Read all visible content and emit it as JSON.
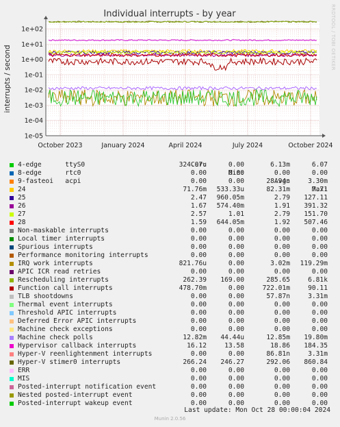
{
  "chart_data": {
    "type": "line",
    "title": "Individual interrupts - by year",
    "ylabel": "interrupts / second",
    "yscale": "log",
    "ylim": [
      1e-05,
      300
    ],
    "y_ticks": [
      "1e+02",
      "1e+01",
      "1e+00",
      "1e-01",
      "1e-02",
      "1e-03",
      "1e-04",
      "1e-05"
    ],
    "x_ticks": [
      "October 2023",
      "January 2024",
      "April 2024",
      "July 2024",
      "October 2024"
    ],
    "grid": true,
    "series": [
      {
        "name": "Hyper-V stimer0 interrupts",
        "color": "#666600",
        "level": 290
      },
      {
        "name": "Hypervisor callback interrupts",
        "color": "#cc00cc",
        "level": 18
      },
      {
        "name": "Rescheduling interrupts",
        "color": "#8fb21d",
        "level": 285
      },
      {
        "name": "24",
        "color": "#ffcc00",
        "level": 3.5
      },
      {
        "name": "25",
        "color": "#330099",
        "level": 2.8
      },
      {
        "name": "27",
        "color": "#ccff00",
        "level": 2.8
      },
      {
        "name": "26",
        "color": "#990099",
        "level": 1.9
      },
      {
        "name": "28",
        "color": "#cc0000",
        "level": 1.9
      },
      {
        "name": "Function call interrupts",
        "color": "#aa0000",
        "level": 0.72
      },
      {
        "name": "Machine check polls",
        "color": "#aa66ff",
        "level": 0.0129
      },
      {
        "name": "IRQ work interrupts",
        "color": "#b08a00",
        "level": 0.003
      },
      {
        "name": "Posted-interrupt wakeup event",
        "color": "#2ec72e",
        "level": 0.003
      }
    ]
  },
  "legend": {
    "header": {
      "cur": "Cur:",
      "min": "Min:",
      "avg": "Avg:",
      "max": "Max:"
    },
    "rows": [
      {
        "name": "4-edge      ttyS0",
        "color": "#00cc00",
        "cur": "324.07u",
        "min": "0.00",
        "avg": "6.13m",
        "max": "6.07"
      },
      {
        "name": "8-edge      rtc0",
        "color": "#0066b3",
        "cur": "0.00",
        "min": "0.00",
        "avg": "0.00",
        "max": "0.00"
      },
      {
        "name": "9-fasteoi   acpi",
        "color": "#ff8000",
        "cur": "0.00",
        "min": "0.00",
        "avg": "28.94n",
        "max": "3.30m"
      },
      {
        "name": "24",
        "color": "#ffcc00",
        "cur": "71.76m",
        "min": "533.33u",
        "avg": "82.31m",
        "max": "7.71"
      },
      {
        "name": "25",
        "color": "#330099",
        "cur": "2.47",
        "min": "960.05m",
        "avg": "2.79",
        "max": "127.11"
      },
      {
        "name": "26",
        "color": "#990099",
        "cur": "1.67",
        "min": "574.40m",
        "avg": "1.91",
        "max": "391.32"
      },
      {
        "name": "27",
        "color": "#ccff00",
        "cur": "2.57",
        "min": "1.01",
        "avg": "2.79",
        "max": "151.70"
      },
      {
        "name": "28",
        "color": "#ff0000",
        "cur": "1.59",
        "min": "644.05m",
        "avg": "1.92",
        "max": "507.46"
      },
      {
        "name": "Non-maskable interrupts",
        "color": "#808080",
        "cur": "0.00",
        "min": "0.00",
        "avg": "0.00",
        "max": "0.00"
      },
      {
        "name": "Local timer interrupts",
        "color": "#008f00",
        "cur": "0.00",
        "min": "0.00",
        "avg": "0.00",
        "max": "0.00"
      },
      {
        "name": "Spurious interrupts",
        "color": "#00487d",
        "cur": "0.00",
        "min": "0.00",
        "avg": "0.00",
        "max": "0.00"
      },
      {
        "name": "Performance monitoring interrupts",
        "color": "#b35a00",
        "cur": "0.00",
        "min": "0.00",
        "avg": "0.00",
        "max": "0.00"
      },
      {
        "name": "IRQ work interrupts",
        "color": "#b38f00",
        "cur": "821.76u",
        "min": "0.00",
        "avg": "3.02m",
        "max": "119.29m"
      },
      {
        "name": "APIC ICR read retries",
        "color": "#6b006b",
        "cur": "0.00",
        "min": "0.00",
        "avg": "0.00",
        "max": "0.00"
      },
      {
        "name": "Rescheduling interrupts",
        "color": "#8fb300",
        "cur": "262.39",
        "min": "169.00",
        "avg": "285.65",
        "max": "6.81k"
      },
      {
        "name": "Function call interrupts",
        "color": "#b30000",
        "cur": "478.70m",
        "min": "0.00",
        "avg": "722.01m",
        "max": "90.11"
      },
      {
        "name": "TLB shootdowns",
        "color": "#bebebe",
        "cur": "0.00",
        "min": "0.00",
        "avg": "57.87n",
        "max": "3.31m"
      },
      {
        "name": "Thermal event interrupts",
        "color": "#80ff80",
        "cur": "0.00",
        "min": "0.00",
        "avg": "0.00",
        "max": "0.00"
      },
      {
        "name": "Threshold APIC interrupts",
        "color": "#80c9ff",
        "cur": "0.00",
        "min": "0.00",
        "avg": "0.00",
        "max": "0.00"
      },
      {
        "name": "Deferred Error APIC interrupts",
        "color": "#ffc080",
        "cur": "0.00",
        "min": "0.00",
        "avg": "0.00",
        "max": "0.00"
      },
      {
        "name": "Machine check exceptions",
        "color": "#ffe680",
        "cur": "0.00",
        "min": "0.00",
        "avg": "0.00",
        "max": "0.00"
      },
      {
        "name": "Machine check polls",
        "color": "#aa80ff",
        "cur": "12.82m",
        "min": "44.44u",
        "avg": "12.85m",
        "max": "19.80m"
      },
      {
        "name": "Hypervisor callback interrupts",
        "color": "#ee00cc",
        "cur": "16.12",
        "min": "13.58",
        "avg": "18.86",
        "max": "184.35"
      },
      {
        "name": "Hyper-V reenlightenment interrupts",
        "color": "#ff8080",
        "cur": "0.00",
        "min": "0.00",
        "avg": "86.81n",
        "max": "3.31m"
      },
      {
        "name": "Hyper-V stimer0 interrupts",
        "color": "#666600",
        "cur": "266.24",
        "min": "246.27",
        "avg": "292.06",
        "max": "860.84"
      },
      {
        "name": "ERR",
        "color": "#ffbfff",
        "cur": "0.00",
        "min": "0.00",
        "avg": "0.00",
        "max": "0.00"
      },
      {
        "name": "MIS",
        "color": "#00ffcc",
        "cur": "0.00",
        "min": "0.00",
        "avg": "0.00",
        "max": "0.00"
      },
      {
        "name": "Posted-interrupt notification event",
        "color": "#cc6699",
        "cur": "0.00",
        "min": "0.00",
        "avg": "0.00",
        "max": "0.00"
      },
      {
        "name": "Nested posted-interrupt event",
        "color": "#999900",
        "cur": "0.00",
        "min": "0.00",
        "avg": "0.00",
        "max": "0.00"
      },
      {
        "name": "Posted-interrupt wakeup event",
        "color": "#00cc00",
        "cur": "0.00",
        "min": "0.00",
        "avg": "0.00",
        "max": "0.00"
      }
    ]
  },
  "last_update": "Last update: Mon Oct 28 00:00:04 2024",
  "footer": "Munin 2.0.56",
  "side_label": "RRDTOOL / TOBI OETIKER"
}
